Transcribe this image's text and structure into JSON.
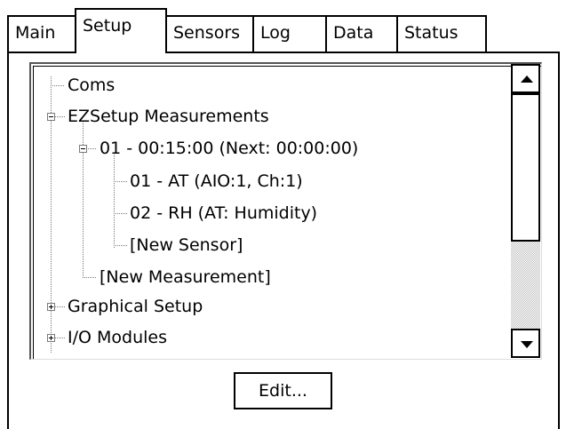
{
  "tabs": [
    {
      "label": "Main",
      "active": false
    },
    {
      "label": "Setup",
      "active": true
    },
    {
      "label": "Sensors",
      "active": false
    },
    {
      "label": "Log",
      "active": false
    },
    {
      "label": "Data",
      "active": false
    },
    {
      "label": "Status",
      "active": false
    }
  ],
  "tree": {
    "items": [
      {
        "label": "Coms",
        "expander": "none"
      },
      {
        "label": "EZSetup Measurements",
        "expander": "minus"
      },
      {
        "label": "01 - 00:15:00 (Next: 00:00:00)",
        "expander": "minus"
      },
      {
        "label": "01 - AT (AIO:1, Ch:1)",
        "expander": "none"
      },
      {
        "label": "02 - RH (AT: Humidity)",
        "expander": "none"
      },
      {
        "label": "[New Sensor]",
        "expander": "none"
      },
      {
        "label": "[New Measurement]",
        "expander": "none"
      },
      {
        "label": "Graphical Setup",
        "expander": "plus"
      },
      {
        "label": "I/O Modules",
        "expander": "plus"
      }
    ]
  },
  "scrollbar": {
    "up_icon": "arrow-up-icon",
    "down_icon": "arrow-down-icon"
  },
  "buttons": {
    "edit_label": "Edit..."
  }
}
